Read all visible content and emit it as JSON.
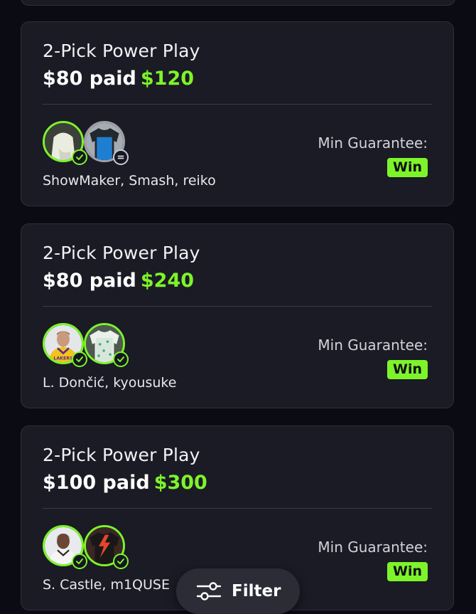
{
  "colors": {
    "accent": "#7df42a",
    "card": "#1a1b25",
    "background": "#0b0b13"
  },
  "cards": [
    {
      "title": "2-Pick Power Play",
      "stake": "$80 paid",
      "payout": "$120",
      "players": "ShowMaker, Smash, reiko",
      "guarantee_label": "Min Guarantee:",
      "result": "Win",
      "picks": [
        {
          "icon": "player-jersey-white",
          "status": "check"
        },
        {
          "icon": "player-jersey-blue",
          "status": "push"
        }
      ]
    },
    {
      "title": "2-Pick Power Play",
      "stake": "$80 paid",
      "payout": "$240",
      "players": "L. Dončić, kyousuke",
      "guarantee_label": "Min Guarantee:",
      "result": "Win",
      "picks": [
        {
          "icon": "player-photo-lakers",
          "status": "check"
        },
        {
          "icon": "player-jersey-green",
          "status": "check"
        }
      ]
    },
    {
      "title": "2-Pick Power Play",
      "stake": "$100 paid",
      "payout": "$300",
      "players": "S. Castle, m1QUSE",
      "guarantee_label": "Min Guarantee:",
      "result": "Win",
      "picks": [
        {
          "icon": "player-photo-spurs",
          "status": "check"
        },
        {
          "icon": "player-jersey-black-red",
          "status": "check"
        }
      ]
    }
  ],
  "filter": {
    "label": "Filter",
    "icon": "sliders-icon"
  }
}
